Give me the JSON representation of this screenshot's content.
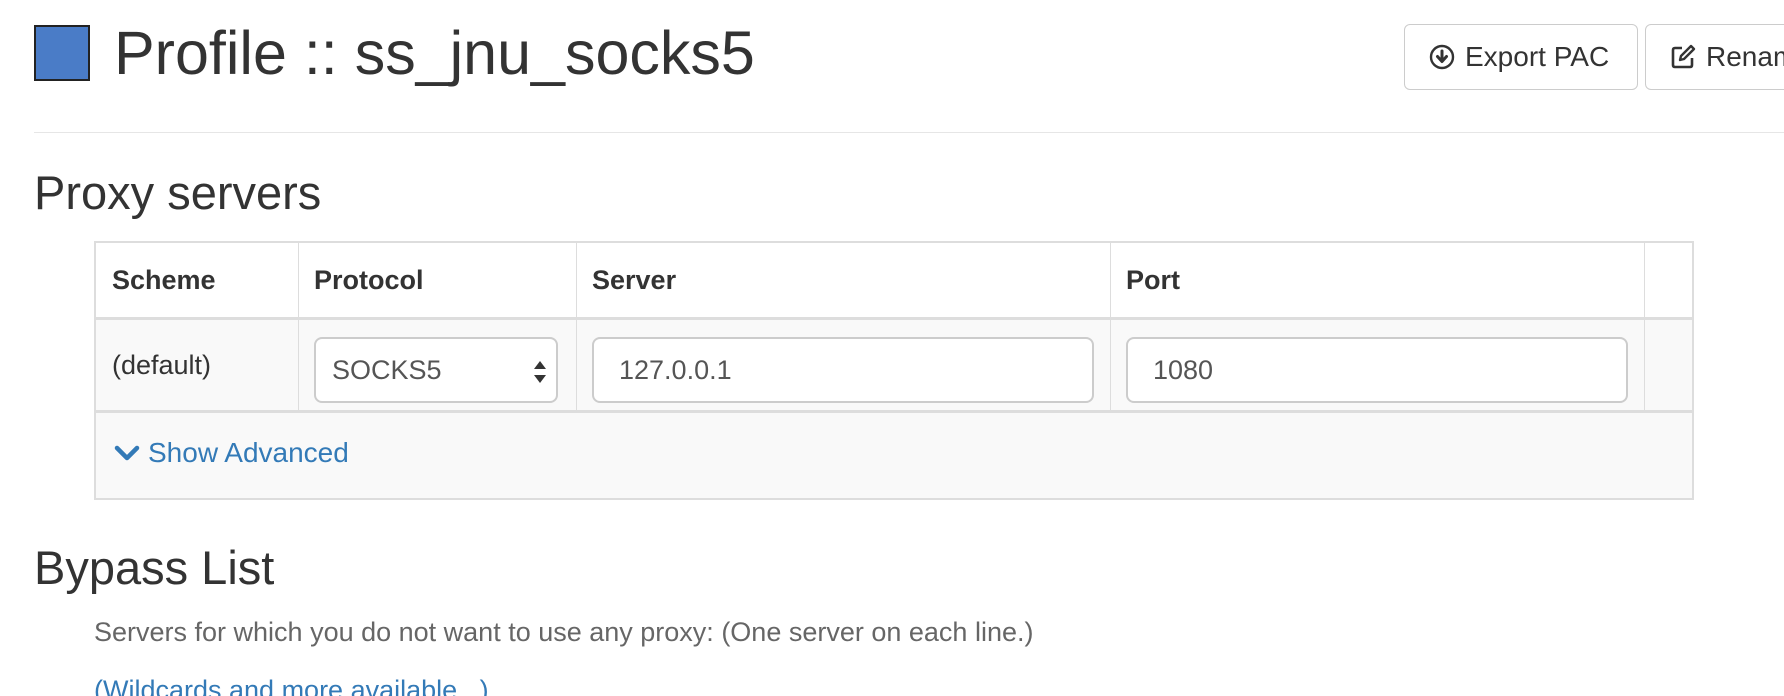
{
  "header": {
    "title": "Profile :: ss_jnu_socks5",
    "profile_color": "#4a7cc7",
    "buttons": {
      "export_pac": {
        "label": "Export PAC",
        "icon": "download-circle-icon"
      },
      "rename": {
        "label": "Renam",
        "icon": "edit-icon"
      }
    }
  },
  "proxy_section": {
    "heading": "Proxy servers",
    "columns": [
      "Scheme",
      "Protocol",
      "Server",
      "Port"
    ],
    "row": {
      "scheme": "(default)",
      "protocol": "SOCKS5",
      "server": "127.0.0.1",
      "port": "1080"
    },
    "show_advanced_label": "Show Advanced",
    "show_advanced_icon": "chevron-down-icon"
  },
  "bypass_section": {
    "heading": "Bypass List",
    "description": "Servers for which you do not want to use any proxy: (One server on each line.)",
    "wildcards_link": "(Wildcards and more available...)"
  },
  "colors": {
    "link": "#337ab7",
    "border": "#dddddd",
    "text": "#333333"
  }
}
